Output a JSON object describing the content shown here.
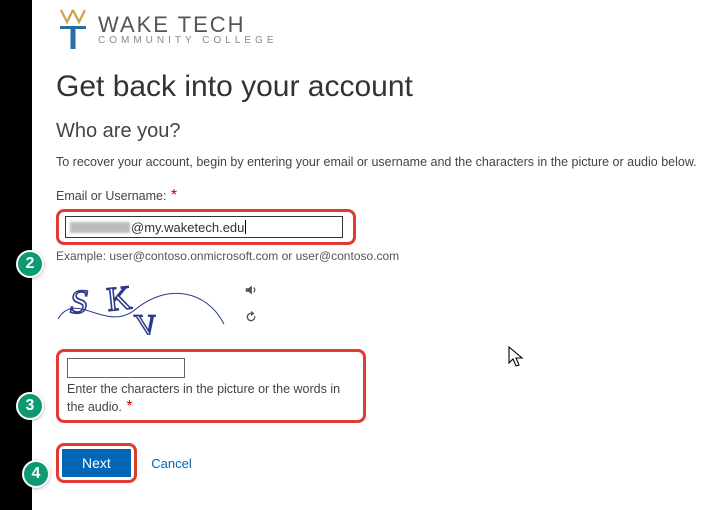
{
  "logo": {
    "line1": "WAKE TECH",
    "line2": "COMMUNITY COLLEGE"
  },
  "heading": "Get back into your account",
  "subheading": "Who are you?",
  "intro": "To recover your account, begin by entering your email or username and the characters in the picture or audio below.",
  "email": {
    "label": "Email or Username:",
    "required_mark": "*",
    "value_suffix": "@my.waketech.edu",
    "example": "Example: user@contoso.onmicrosoft.com or user@contoso.com"
  },
  "captcha": {
    "display_text": "SKV",
    "help": "Enter the characters in the picture or the words in the audio.",
    "required_mark": "*"
  },
  "buttons": {
    "next": "Next",
    "cancel": "Cancel"
  },
  "markers": {
    "m2": "2",
    "m3": "3",
    "m4": "4"
  }
}
